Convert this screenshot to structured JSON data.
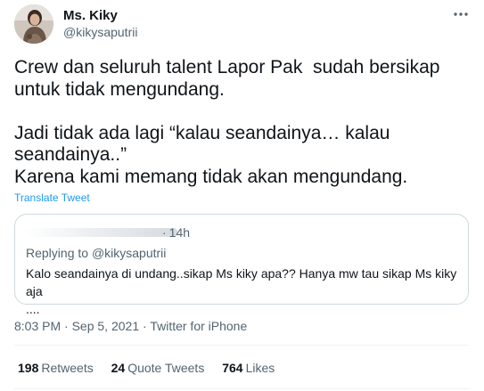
{
  "author": {
    "display_name": "Ms. Kiky",
    "handle": "@kikysaputrii"
  },
  "icons": {
    "more": "more-horizontal-icon",
    "avatar": "profile-photo"
  },
  "tweet": {
    "text": "Crew dan seluruh talent Lapor Pak  sudah bersikap\nuntuk tidak mengundang.\n\nJadi tidak ada lagi “kalau seandainya… kalau\nseandainya..”\nKarena kami memang tidak akan mengundang.",
    "translate_label": "Translate Tweet"
  },
  "quote": {
    "time": "14h",
    "replying_prefix": "Replying to",
    "replying_to": "@kikysaputrii",
    "text": "Kalo seandainya di undang..sikap Ms kiky apa?? Hanya mw tau sikap Ms kiky aja\n...."
  },
  "meta": {
    "time": "8:03 PM",
    "date": "Sep 5, 2021",
    "source": "Twitter for iPhone"
  },
  "stats": {
    "retweets_count": "198",
    "retweets_label": "Retweets",
    "quotes_count": "24",
    "quotes_label": "Quote Tweets",
    "likes_count": "764",
    "likes_label": "Likes"
  },
  "colors": {
    "link": "#1d9bf0",
    "secondary_text": "#536471",
    "primary_text": "#0f1419",
    "border": "#cfd9de"
  }
}
